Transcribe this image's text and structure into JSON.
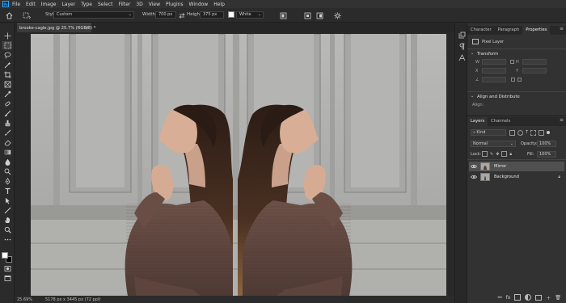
{
  "menubar": {
    "items": [
      "File",
      "Edit",
      "Image",
      "Layer",
      "Type",
      "Select",
      "Filter",
      "3D",
      "View",
      "Plugins",
      "Window",
      "Help"
    ]
  },
  "options": {
    "style_label": "Style:",
    "style_value": "Custom",
    "width_label": "Width:",
    "width_value": "700 px",
    "height_label": "Height:",
    "height_value": "375 px",
    "color_value": "White"
  },
  "document": {
    "tab_title": "brooke-cagle.jpg @ 25.7% (RGB/8) *",
    "zoom": "25.69%",
    "doc_size": "5178 px x 3445 px (72 ppi)"
  },
  "panels": {
    "top_tabs": [
      "Character",
      "Paragraph",
      "Properties"
    ],
    "properties": {
      "kind": "Pixel Layer",
      "transform_title": "Transform",
      "align_title": "Align and Distribute",
      "align_label": "Align:"
    },
    "layers_tabs": [
      "Layers",
      "Channels"
    ],
    "filter_kind": "Kind",
    "blend_mode": "Normal",
    "opacity_label": "Opacity:",
    "opacity_value": "100%",
    "lock_label": "Lock:",
    "fill_label": "Fill:",
    "fill_value": "100%",
    "layers": [
      {
        "name": "Mirror",
        "selected": true
      },
      {
        "name": "Background",
        "selected": false
      }
    ]
  },
  "colors": {
    "app_bg": "#282828",
    "panel_bg": "#323232",
    "accent": "#31a8ff",
    "selected_layer": "#505050"
  }
}
